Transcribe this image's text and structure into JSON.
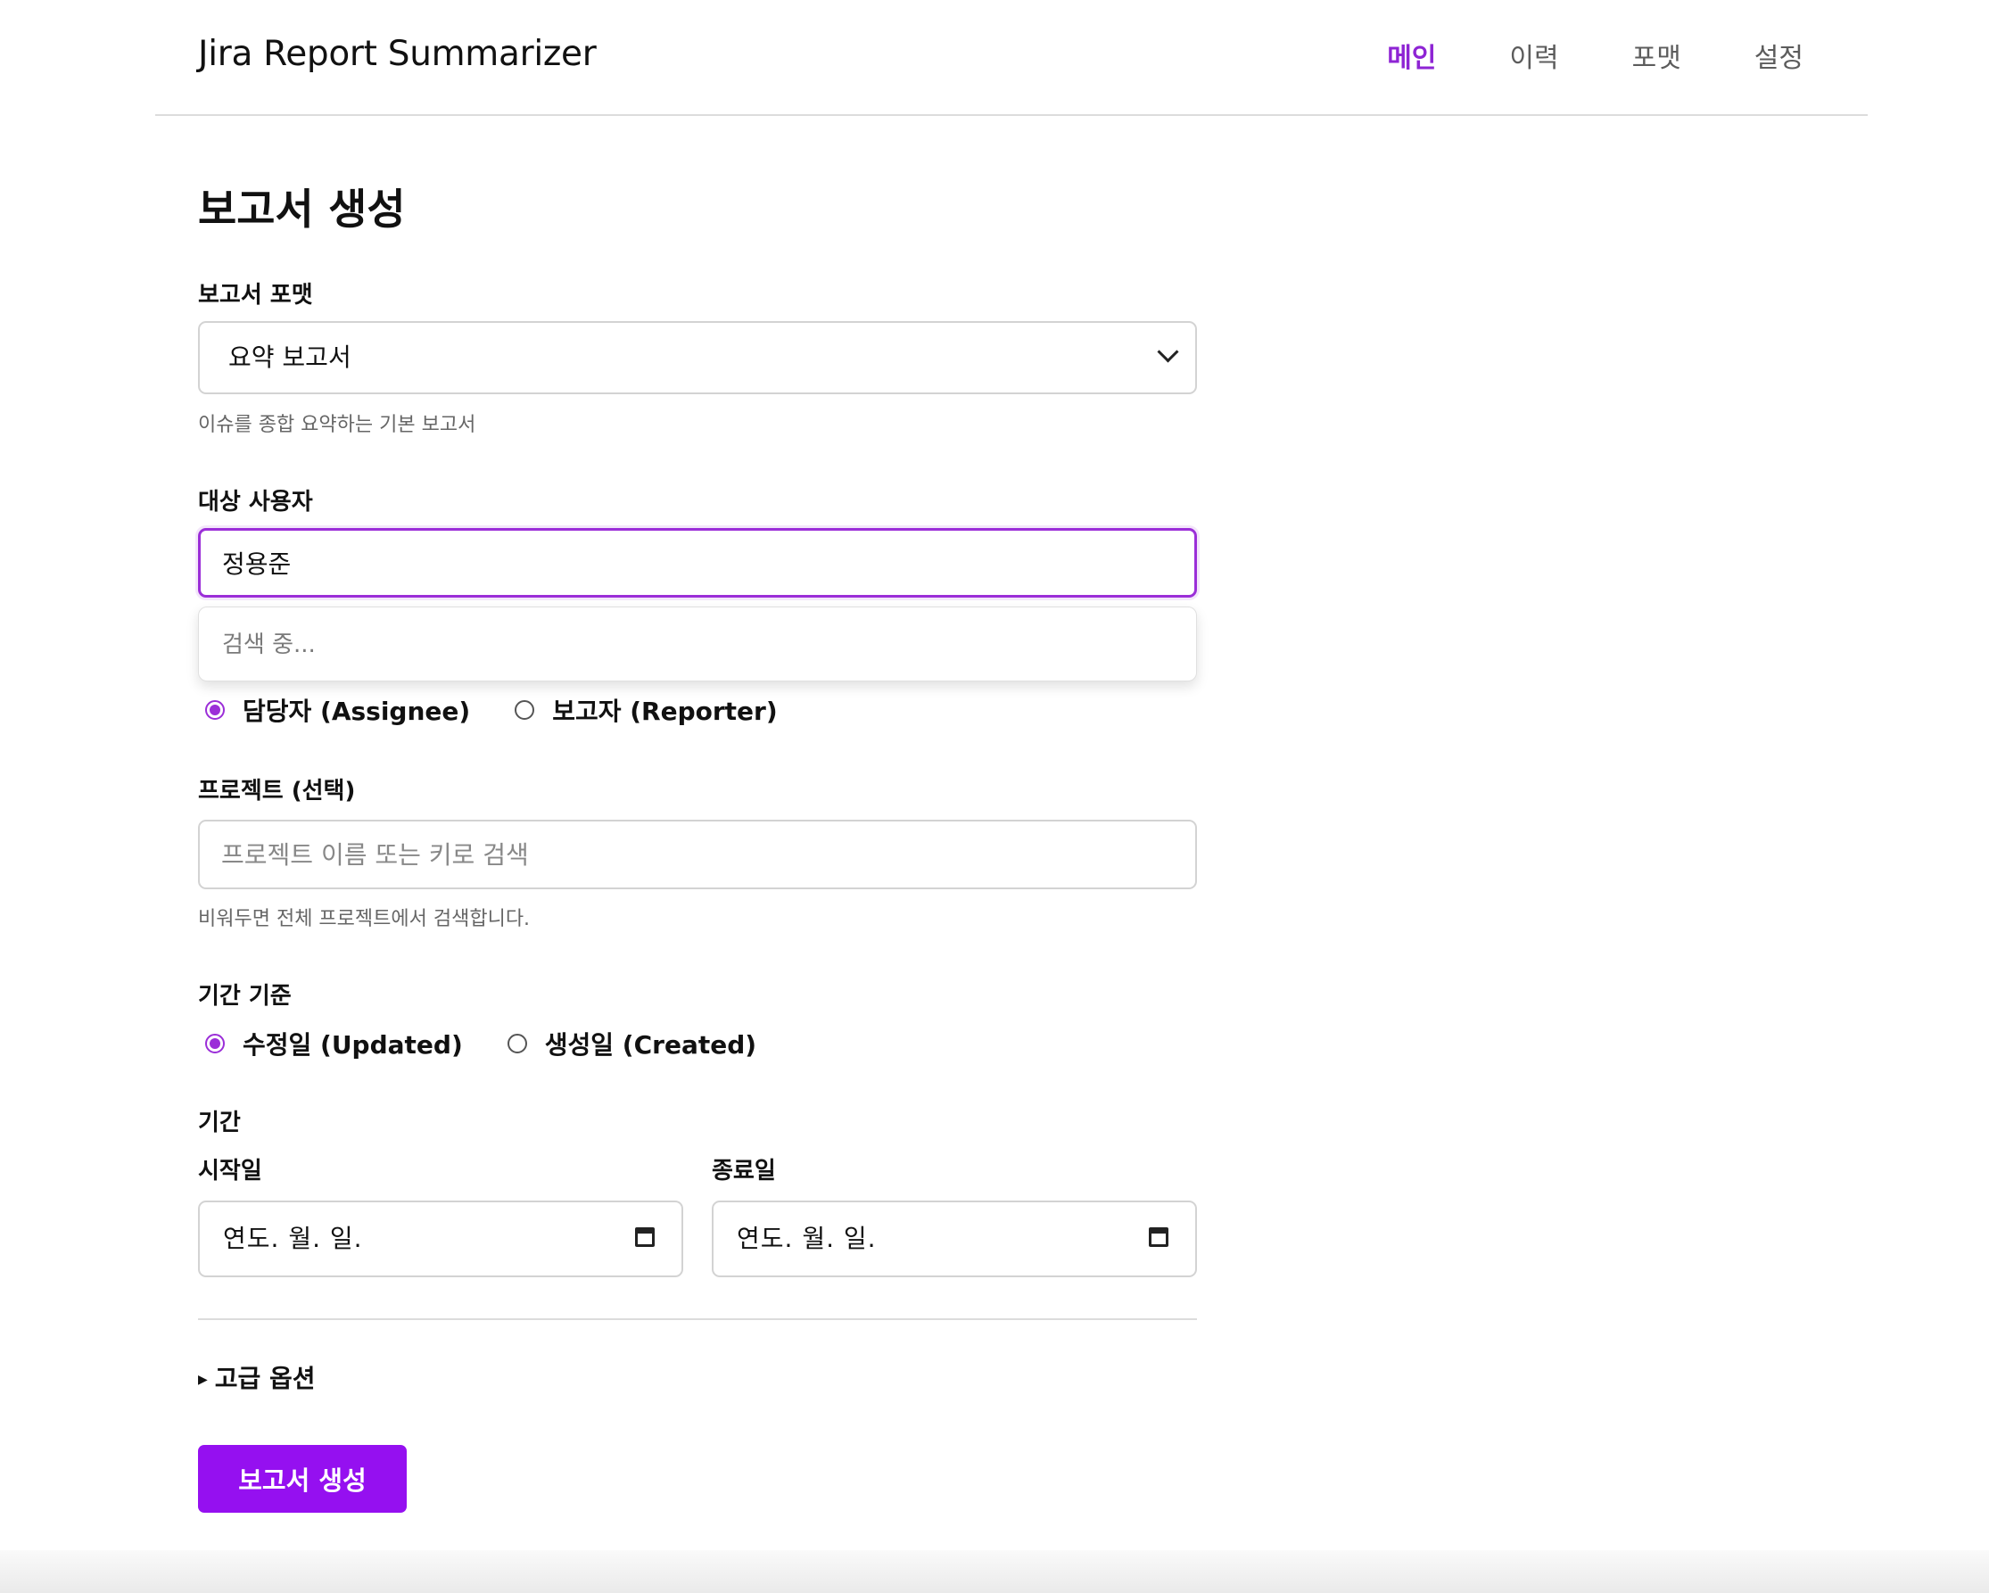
{
  "header": {
    "app_title": "Jira Report Summarizer",
    "nav": [
      "메인",
      "이력",
      "포맷",
      "설정"
    ],
    "active_nav": "메인"
  },
  "main": {
    "page_title": "보고서 생성",
    "format": {
      "label": "보고서 포맷",
      "selected": "요약 보고서",
      "hint": "이슈를 종합 요약하는 기본 보고서"
    },
    "user": {
      "label": "대상 사용자",
      "value": "정용준",
      "dropdown_status": "검색 중..."
    },
    "role": {
      "options": [
        "담당자 (Assignee)",
        "보고자 (Reporter)"
      ],
      "selected": "담당자 (Assignee)"
    },
    "project": {
      "label": "프로젝트 (선택)",
      "placeholder": "프로젝트 이름 또는 키로 검색",
      "hint": "비워두면 전체 프로젝트에서 검색합니다."
    },
    "period_basis": {
      "label": "기간 기준",
      "options": [
        "수정일 (Updated)",
        "생성일 (Created)"
      ],
      "selected": "수정일 (Updated)"
    },
    "period": {
      "label": "기간",
      "start_label": "시작일",
      "end_label": "종료일",
      "start_value": "연도. 월. 일.",
      "end_value": "연도. 월. 일."
    },
    "advanced_label": "고급 옵션",
    "submit_label": "보고서 생성"
  },
  "colors": {
    "accent": "#9510f0",
    "active_nav": "#8e24d4",
    "focus_border": "#9b2ed8"
  },
  "icons": [
    "chevron-down-icon",
    "calendar-icon",
    "disclosure-triangle-icon"
  ]
}
